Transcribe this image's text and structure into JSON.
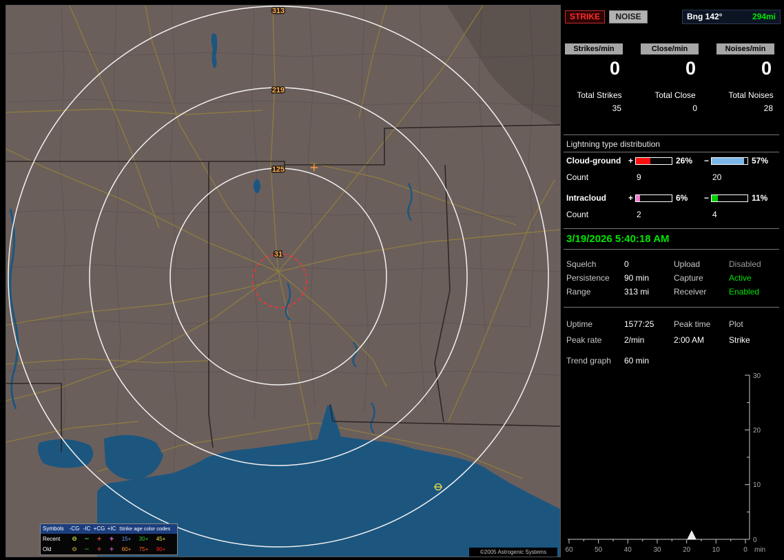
{
  "colors": {
    "accent_green": "#00e400",
    "strike_red": "#ff2a2a",
    "map_land": "#6b5f5c",
    "map_water": "#1c567f",
    "map_road": "#92803a",
    "ring_label_orange": "#ffb052",
    "disabled_gray": "#9a9a9a"
  },
  "map": {
    "ring_labels": [
      "313",
      "219",
      "125",
      "31"
    ],
    "copyright": "©2005 Astrogenic Systems",
    "legend": {
      "symbols_header": "Symbols",
      "type_headers": [
        "-CG",
        "-IC",
        "+CG",
        "+IC"
      ],
      "age_header": "Strike age color codes",
      "recent": {
        "label": "Recent",
        "symbols": [
          {
            "glyph": "⊖",
            "color": "#d8e04a"
          },
          {
            "glyph": "−",
            "color": "#46e046"
          },
          {
            "glyph": "+",
            "color": "#ff5050"
          },
          {
            "glyph": "+",
            "color": "#ff70ff"
          }
        ],
        "ages": [
          {
            "text": "15+",
            "color": "#6f9fff"
          },
          {
            "text": "30+",
            "color": "#2ecc2e"
          },
          {
            "text": "45+",
            "color": "#e8e040"
          }
        ]
      },
      "old": {
        "label": "Old",
        "symbols": [
          {
            "glyph": "⊖",
            "color": "#b0a032"
          },
          {
            "glyph": "−",
            "color": "#2e9a2e"
          },
          {
            "glyph": "+",
            "color": "#c04040"
          },
          {
            "glyph": "+",
            "color": "#c060c0"
          }
        ],
        "ages": [
          {
            "text": "60+",
            "color": "#ff9a2e"
          },
          {
            "text": "75+",
            "color": "#ff5c20"
          },
          {
            "text": "90+",
            "color": "#ff2020"
          }
        ]
      }
    }
  },
  "sidebar": {
    "strike_button": "STRIKE",
    "noise_button": "NOISE",
    "bearing_label": "Bng 142°",
    "bearing_distance": "294mi",
    "rate_boxes": [
      {
        "label": "Strikes/min",
        "value": "0"
      },
      {
        "label": "Close/min",
        "value": "0"
      },
      {
        "label": "Noises/min",
        "value": "0"
      }
    ],
    "totals": [
      {
        "label": "Total Strikes",
        "value": "35"
      },
      {
        "label": "Total Close",
        "value": "0"
      },
      {
        "label": "Total Noises",
        "value": "28"
      }
    ],
    "distribution": {
      "title": "Lightning type distribution",
      "count_label": "Count",
      "plus_sign": "+",
      "minus_sign": "−",
      "rows": [
        {
          "label": "Cloud-ground",
          "plus_pct": "26%",
          "plus_fill": "41%",
          "plus_color": "#ff0e0e",
          "plus_count": "9",
          "minus_pct": "57%",
          "minus_fill": "90%",
          "minus_color": "#7db6e8",
          "minus_count": "20"
        },
        {
          "label": "Intracloud",
          "plus_pct": "6%",
          "plus_fill": "11%",
          "plus_color": "#ee7ecb",
          "plus_count": "2",
          "minus_pct": "11%",
          "minus_fill": "18%",
          "minus_color": "#00d000",
          "minus_count": "4"
        }
      ]
    },
    "datetime": "3/19/2026 5:40:18 AM",
    "settings": [
      {
        "label": "Squelch",
        "value": "0",
        "label2": "Upload",
        "value2": "Disabled",
        "value2_color": "#9a9a9a"
      },
      {
        "label": "Persistence",
        "value": "90 min",
        "label2": "Capture",
        "value2": "Active",
        "value2_color": "#00e400"
      },
      {
        "label": "Range",
        "value": "313 mi",
        "label2": "Receiver",
        "value2": "Enabled",
        "value2_color": "#00e400"
      }
    ],
    "stats_row1": {
      "c1": "Uptime",
      "c2": "1577:25",
      "c3": "Peak time",
      "c4": "Plot"
    },
    "stats_row2": {
      "c1": "Peak rate",
      "c2": "2/min",
      "c3": "2:00 AM",
      "c4": "Strike"
    },
    "trend": {
      "label": "Trend graph",
      "window": "60 min",
      "y_ticks": [
        "30",
        "20",
        "10",
        "0"
      ],
      "x_ticks": [
        "60",
        "50",
        "40",
        "30",
        "20",
        "10",
        "0"
      ],
      "x_unit": "min",
      "series": "Strike",
      "spike": {
        "minutes_ago": 20,
        "value": 2
      }
    }
  }
}
